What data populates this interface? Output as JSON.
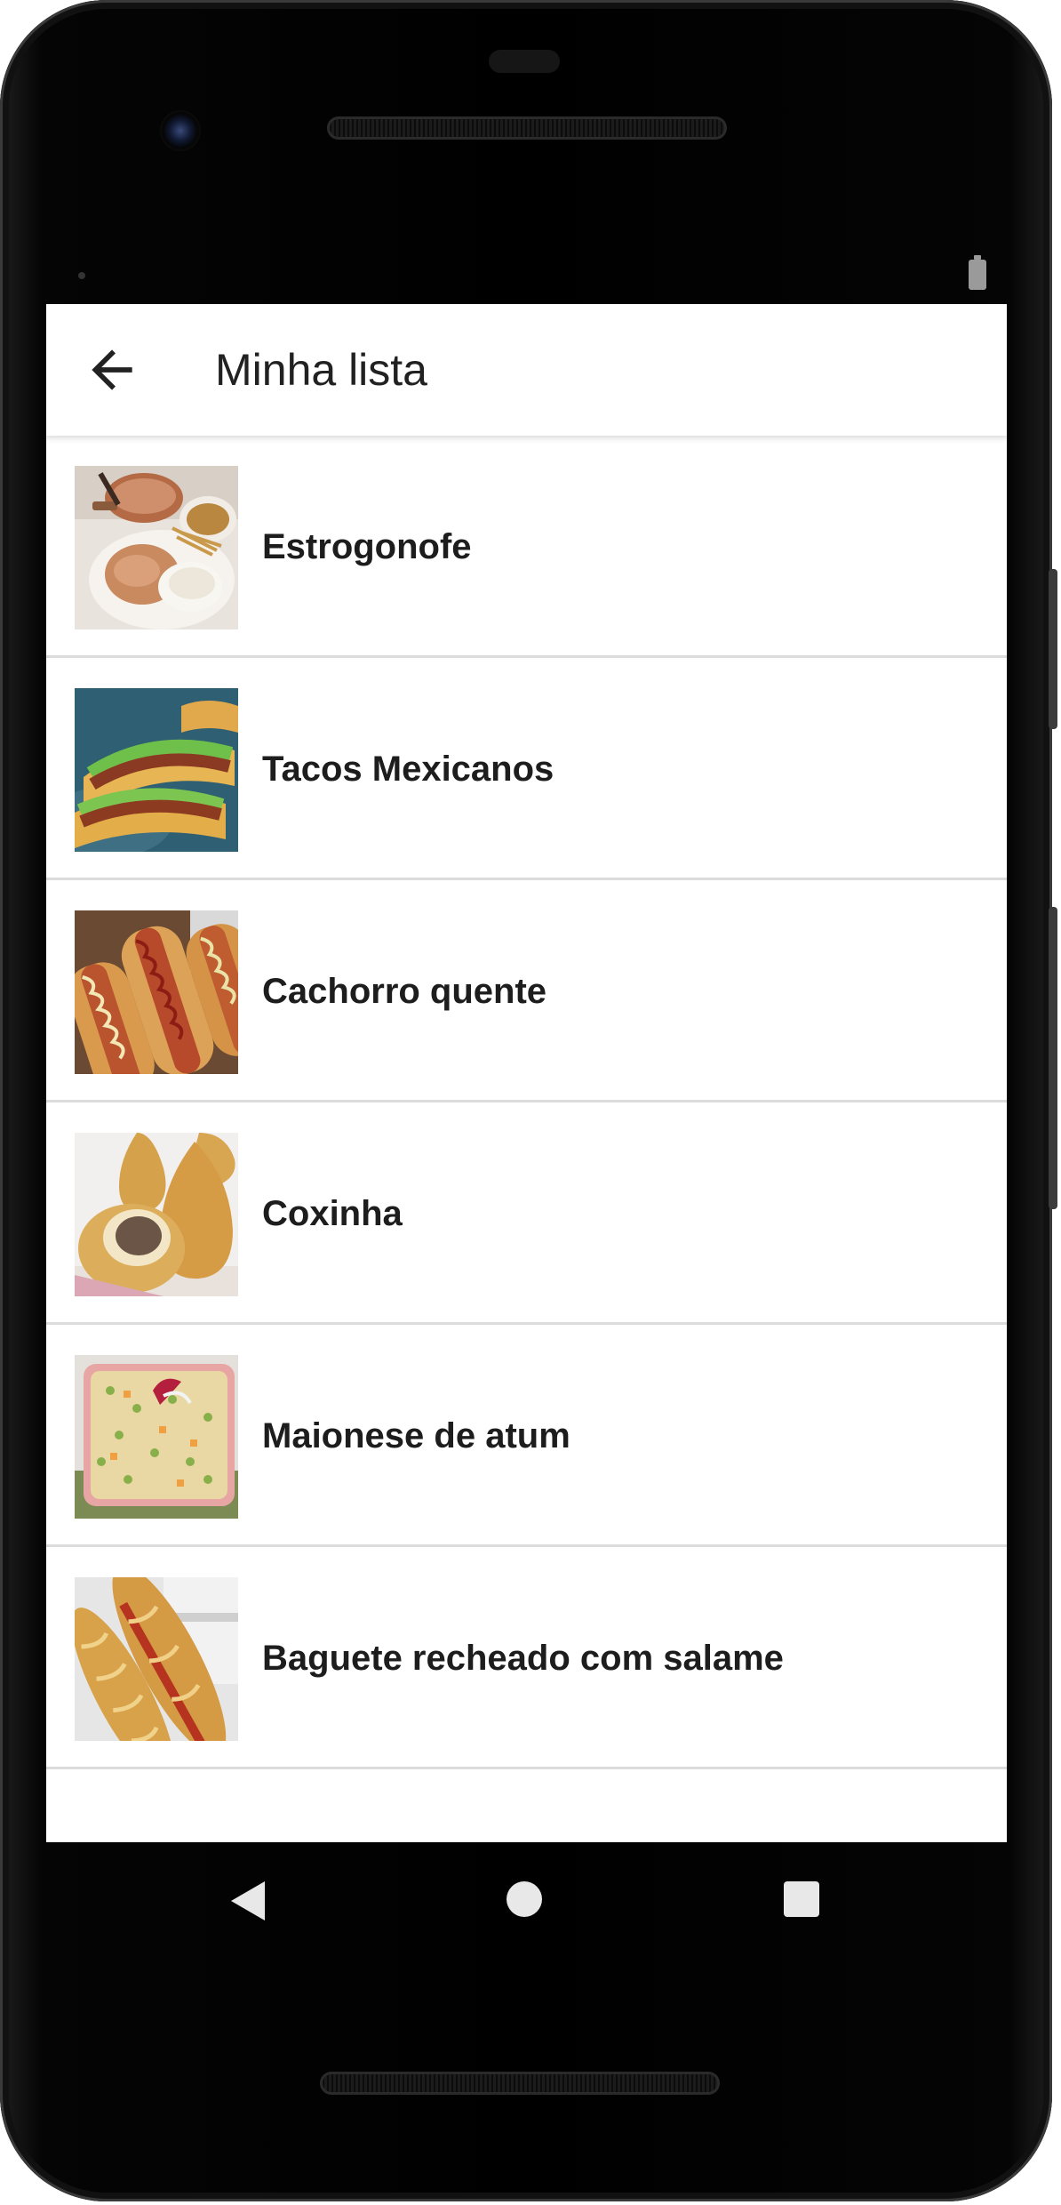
{
  "app_bar": {
    "title": "Minha lista",
    "back_icon": "arrow-left-icon"
  },
  "recipes": [
    {
      "name": "Estrogonofe",
      "image": "stroganoff-photo"
    },
    {
      "name": "Tacos Mexicanos",
      "image": "tacos-photo"
    },
    {
      "name": "Cachorro quente",
      "image": "hot-dog-photo"
    },
    {
      "name": "Coxinha",
      "image": "coxinha-photo"
    },
    {
      "name": "Maionese de atum",
      "image": "tuna-salad-photo"
    },
    {
      "name": "Baguete recheado com salame",
      "image": "baguette-photo"
    }
  ],
  "nav_bar": {
    "back_icon": "triangle-back-icon",
    "home_icon": "circle-home-icon",
    "recents_icon": "square-recents-icon"
  },
  "colors": {
    "screen_bg": "#ffffff",
    "divider": "#dcdcdc",
    "text": "#1d1d1d",
    "device": "#000000"
  }
}
